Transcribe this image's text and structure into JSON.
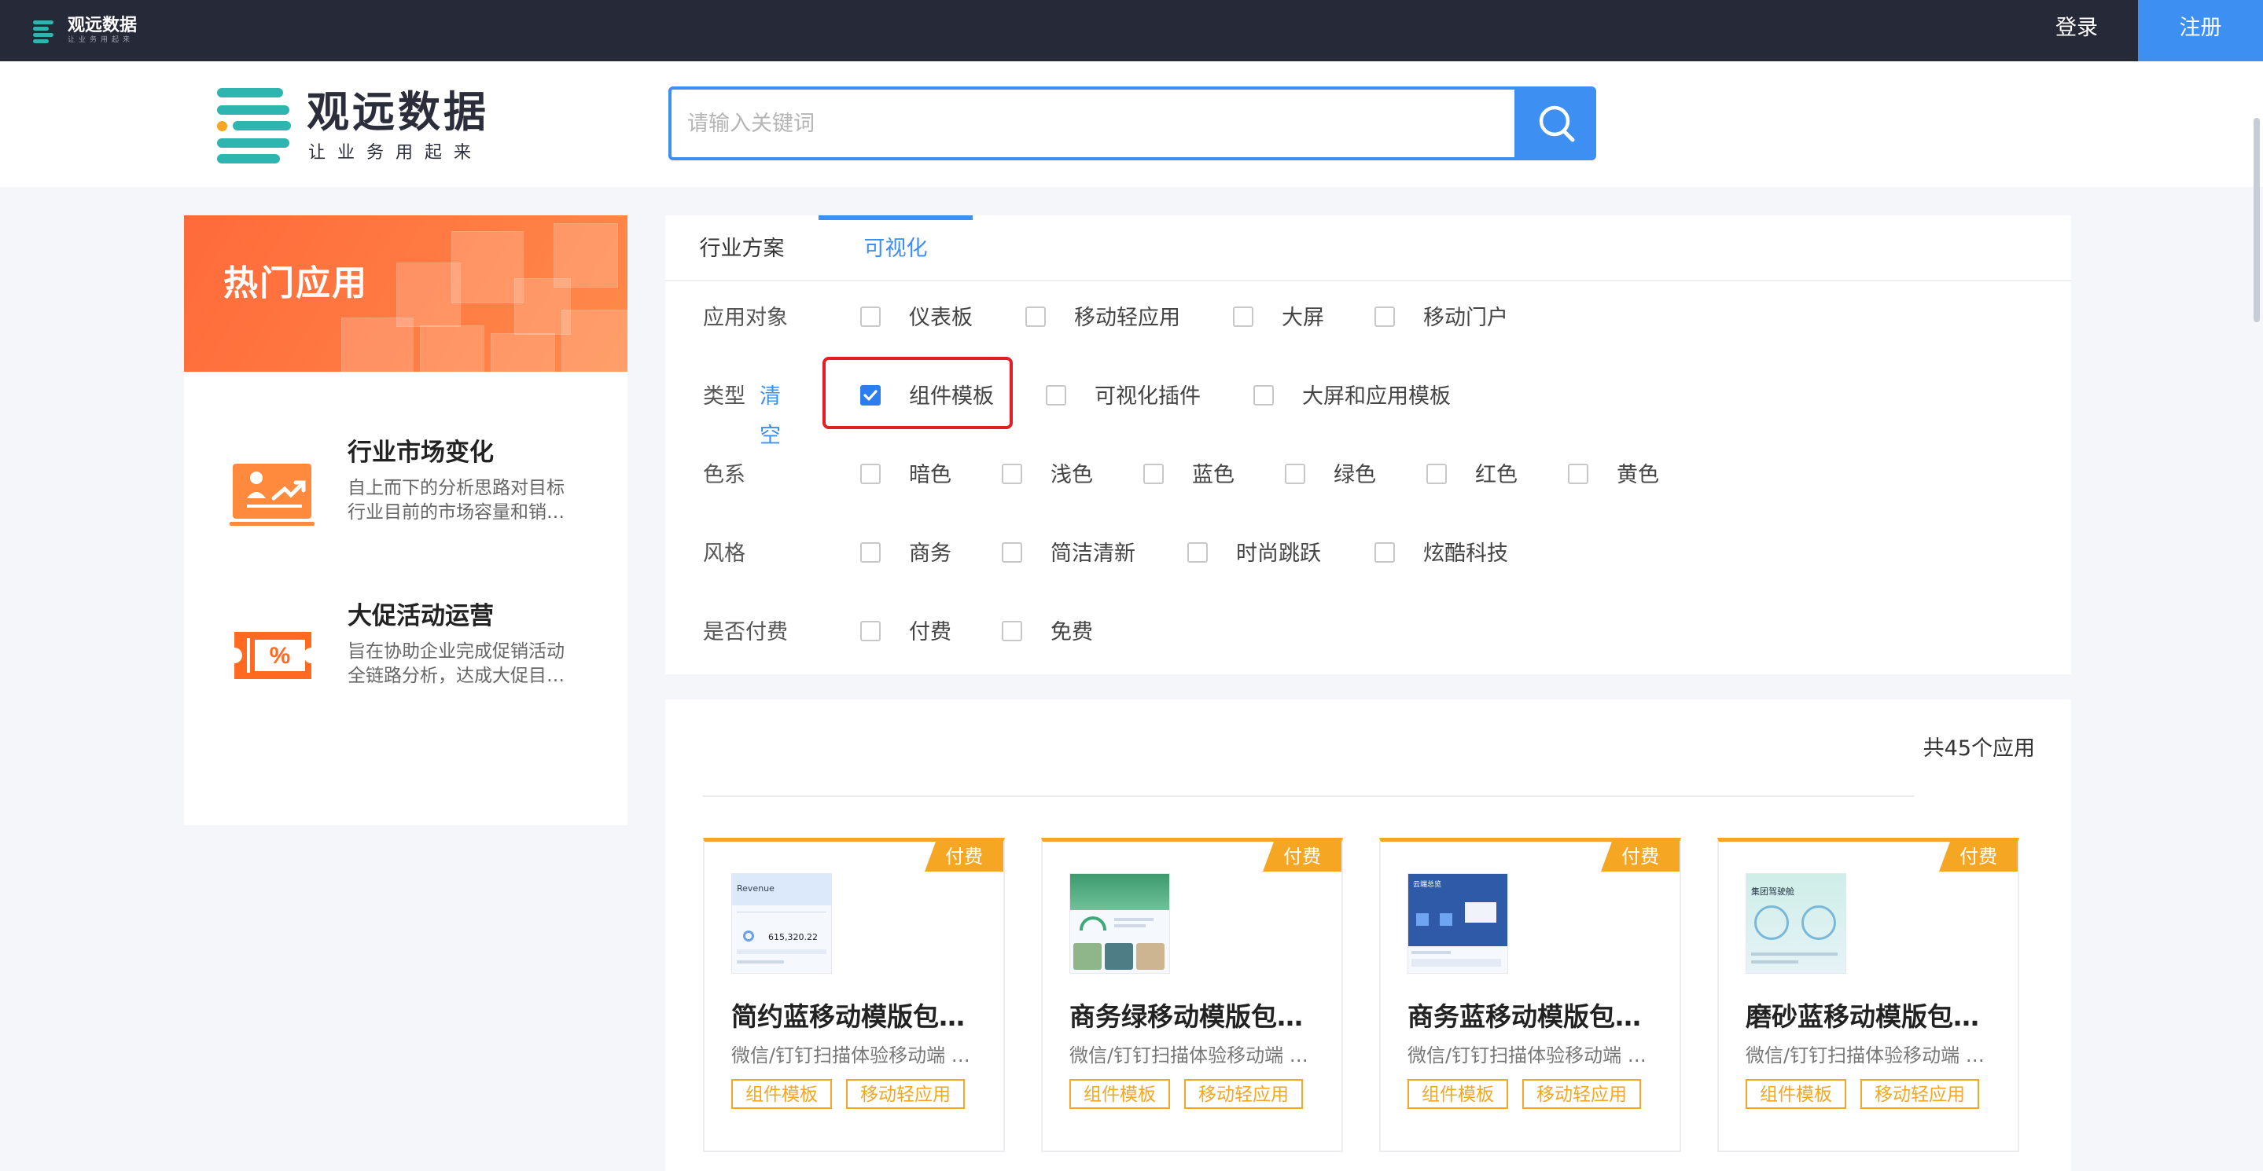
{
  "topbar": {
    "logo_text": "观远数据",
    "logo_slogan": "让业务用起来",
    "login_label": "登录",
    "register_label": "注册"
  },
  "header": {
    "brand_name": "观远数据",
    "brand_slogan": "让业务用起来",
    "search_placeholder": "请输入关键词"
  },
  "hot": {
    "title": "热门应用",
    "items": [
      {
        "title": "行业市场变化",
        "desc_line1": "自上而下的分析思路对目标",
        "desc_line2": "行业目前的市场容量和销…"
      },
      {
        "title": "大促活动运营",
        "desc_line1": "旨在协助企业完成促销活动",
        "desc_line2": "全链路分析，达成大促目…"
      }
    ]
  },
  "tabs": [
    {
      "label": "行业方案",
      "active": false
    },
    {
      "label": "可视化",
      "active": true
    }
  ],
  "filters": {
    "target": {
      "label": "应用对象",
      "options": [
        "仪表板",
        "移动轻应用",
        "大屏",
        "移动门户"
      ]
    },
    "type": {
      "label": "类型",
      "clear": "清空",
      "options": [
        "组件模板",
        "可视化插件",
        "大屏和应用模板"
      ],
      "checked": "组件模板"
    },
    "color": {
      "label": "色系",
      "options": [
        "暗色",
        "浅色",
        "蓝色",
        "绿色",
        "红色",
        "黄色"
      ]
    },
    "style": {
      "label": "风格",
      "options": [
        "商务",
        "简洁清新",
        "时尚跳跃",
        "炫酷科技"
      ]
    },
    "paid": {
      "label": "是否付费",
      "options": [
        "付费",
        "免费"
      ]
    }
  },
  "results": {
    "count_text": "共45个应用",
    "cards": [
      {
        "badge": "付费",
        "title": "简约蓝移动模版包…",
        "subtitle": "微信/钉钉扫描体验移动端 …",
        "tags": [
          "组件模板",
          "移动轻应用"
        ],
        "thumb_title": "Revenue",
        "thumb_value": "615,320.22"
      },
      {
        "badge": "付费",
        "title": "商务绿移动模版包…",
        "subtitle": "微信/钉钉扫描体验移动端 …",
        "tags": [
          "组件模板",
          "移动轻应用"
        ]
      },
      {
        "badge": "付费",
        "title": "商务蓝移动模版包…",
        "subtitle": "微信/钉钉扫描体验移动端 …",
        "tags": [
          "组件模板",
          "移动轻应用"
        ],
        "thumb_title": "云端总览"
      },
      {
        "badge": "付费",
        "title": "磨砂蓝移动模版包…",
        "subtitle": "微信/钉钉扫描体验移动端 …",
        "tags": [
          "组件模板",
          "移动轻应用"
        ],
        "thumb_title": "集团驾驶舱"
      }
    ]
  },
  "colors": {
    "accent_blue": "#3d8ff2",
    "orange": "#f5a623",
    "hot_orange": "#ff6a3a",
    "highlight_red": "#e41e24",
    "topbar": "#262938"
  }
}
